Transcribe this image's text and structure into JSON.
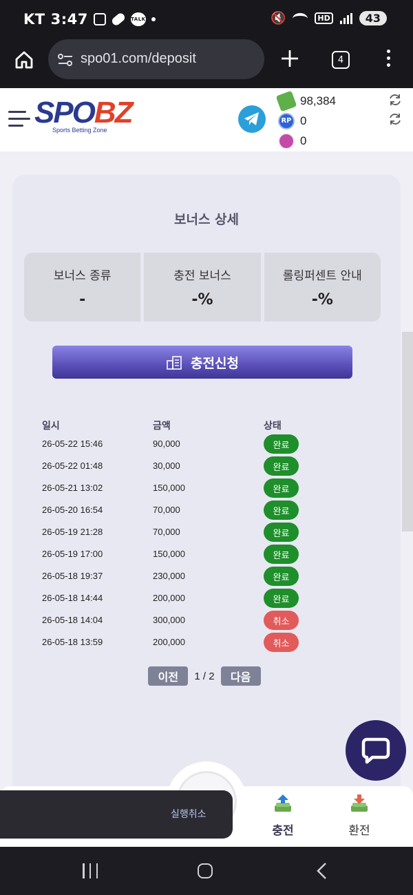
{
  "status_bar": {
    "carrier": "KT",
    "time": "3:47",
    "talk_badge": "TALK",
    "network": "HD",
    "battery": "43"
  },
  "browser": {
    "url": "spo01.com/deposit",
    "tab_count": "4"
  },
  "header": {
    "logo_part1": "SPO",
    "logo_part2": "BZ",
    "logo_tagline": "Sports Betting Zone",
    "balance_money": "98,384",
    "balance_rp": "0",
    "balance_coin": "0",
    "rp_badge": "RP"
  },
  "card": {
    "title": "보너스 상세",
    "bonus": [
      {
        "label": "보너스 종류",
        "value": "-"
      },
      {
        "label": "충전 보너스",
        "value": "-%"
      },
      {
        "label": "롤링퍼센트 안내",
        "value": "-%"
      }
    ],
    "deposit_button": "충전신청"
  },
  "history": {
    "columns": [
      "일시",
      "금액",
      "상태"
    ],
    "rows": [
      {
        "date": "26-05-22 15:46",
        "amount": "90,000",
        "status": "완료",
        "state": "done"
      },
      {
        "date": "26-05-22 01:48",
        "amount": "30,000",
        "status": "완료",
        "state": "done"
      },
      {
        "date": "26-05-21 13:02",
        "amount": "150,000",
        "status": "완료",
        "state": "done"
      },
      {
        "date": "26-05-20 16:54",
        "amount": "70,000",
        "status": "완료",
        "state": "done"
      },
      {
        "date": "26-05-19 21:28",
        "amount": "70,000",
        "status": "완료",
        "state": "done"
      },
      {
        "date": "26-05-19 17:00",
        "amount": "150,000",
        "status": "완료",
        "state": "done"
      },
      {
        "date": "26-05-18 19:37",
        "amount": "230,000",
        "status": "완료",
        "state": "done"
      },
      {
        "date": "26-05-18 14:44",
        "amount": "200,000",
        "status": "완료",
        "state": "done"
      },
      {
        "date": "26-05-18 14:04",
        "amount": "300,000",
        "status": "취소",
        "state": "cancel"
      },
      {
        "date": "26-05-18 13:59",
        "amount": "200,000",
        "status": "취소",
        "state": "cancel"
      }
    ],
    "prev_label": "이전",
    "next_label": "다음",
    "page_info": "1 / 2"
  },
  "bottom_nav": {
    "deposit_label": "충전",
    "withdraw_label": "환전"
  },
  "toast": {
    "text": "실행취소"
  },
  "colors": {
    "done_badge": "#1e8f2a",
    "cancel_badge": "#e25a5a",
    "deposit_button": "#5a4fb8",
    "chat_button": "#2b2567"
  }
}
